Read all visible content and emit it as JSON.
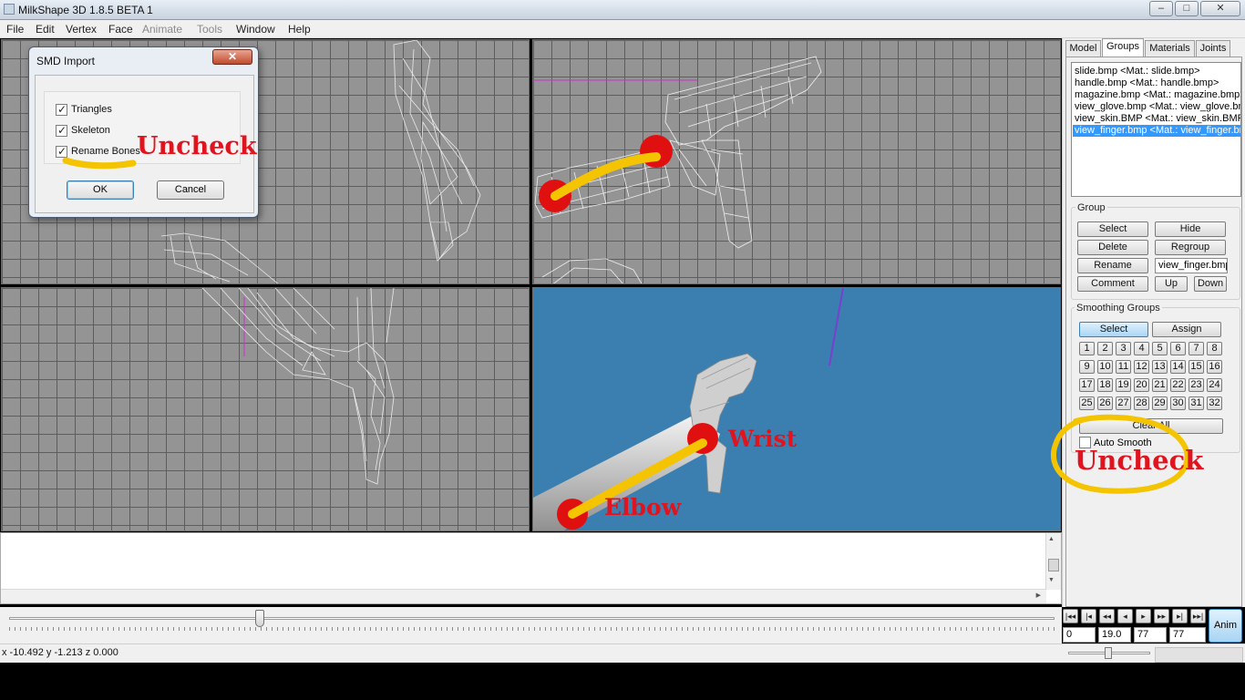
{
  "window": {
    "title": "MilkShape 3D 1.8.5 BETA 1",
    "minimize": "–",
    "maximize": "□",
    "close": "✕"
  },
  "menu": [
    "File",
    "Edit",
    "Vertex",
    "Face",
    "Animate",
    "Tools",
    "Window",
    "Help"
  ],
  "dialog": {
    "title": "SMD Import",
    "close": "✕",
    "options": [
      {
        "label": "Triangles",
        "checked": true
      },
      {
        "label": "Skeleton",
        "checked": true
      },
      {
        "label": "Rename Bones",
        "checked": true
      }
    ],
    "ok": "OK",
    "cancel": "Cancel"
  },
  "annotations": {
    "uncheck_1": "Uncheck",
    "uncheck_2": "Uncheck",
    "wrist": "Wrist",
    "elbow": "Elbow"
  },
  "panel": {
    "tabs": [
      "Model",
      "Groups",
      "Materials",
      "Joints"
    ],
    "active_tab": "Groups",
    "groups_list": [
      "slide.bmp <Mat.: slide.bmp>",
      "handle.bmp <Mat.: handle.bmp>",
      "magazine.bmp <Mat.: magazine.bmp>",
      "view_glove.bmp <Mat.: view_glove.bmp>",
      "view_skin.BMP <Mat.: view_skin.BMP>",
      "view_finger.bmp <Mat.: view_finger.bmp>"
    ],
    "selected_index": 5,
    "group": {
      "label": "Group",
      "select": "Select",
      "hide": "Hide",
      "delete": "Delete",
      "regroup": "Regroup",
      "rename": "Rename",
      "name_value": "view_finger.bmp",
      "comment": "Comment",
      "up": "Up",
      "down": "Down"
    },
    "smoothing": {
      "label": "Smoothing Groups",
      "select": "Select",
      "assign": "Assign",
      "numbers": [
        "1",
        "2",
        "3",
        "4",
        "5",
        "6",
        "7",
        "8",
        "9",
        "10",
        "11",
        "12",
        "13",
        "14",
        "15",
        "16",
        "17",
        "18",
        "19",
        "20",
        "21",
        "22",
        "23",
        "24",
        "25",
        "26",
        "27",
        "28",
        "29",
        "30",
        "31",
        "32"
      ],
      "clear_all": "Clear All",
      "auto_smooth": "Auto Smooth",
      "auto_smooth_checked": false
    }
  },
  "timeline": {
    "slider_fraction": 0.24,
    "playback_buttons": [
      "|◂◂",
      "|◂",
      "◂◂",
      "◂",
      "▸",
      "▸▸",
      "▸|",
      "▸▸|"
    ],
    "fields": [
      "0",
      "19.0",
      "77",
      "77"
    ],
    "anim_button": "Anim"
  },
  "status": {
    "coords": "x -10.492 y -1.213 z 0.000"
  },
  "colors": {
    "viewport_grid": "#949494",
    "viewport_3d": "#3a7fb0",
    "annotation_red": "#e0141e",
    "annotation_yellow": "#f5c400",
    "selection": "#3399ff"
  }
}
